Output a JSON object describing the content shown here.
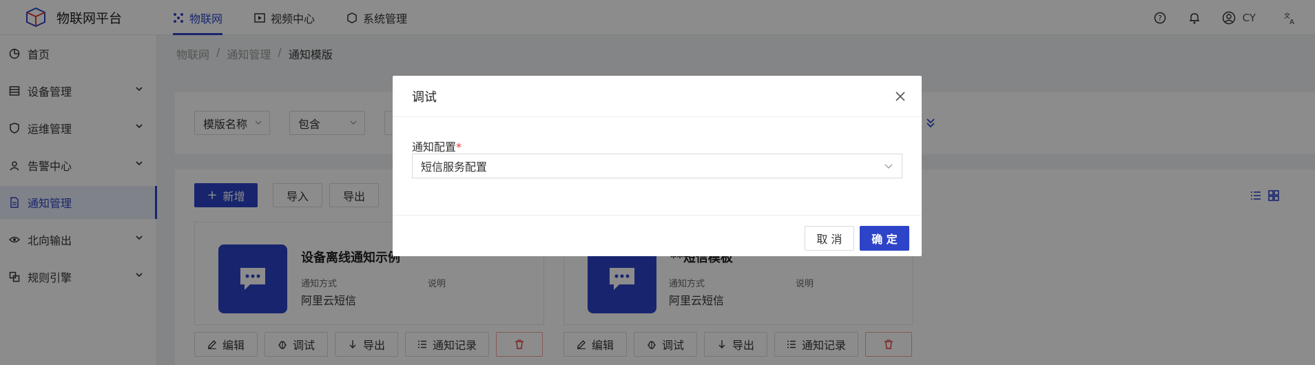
{
  "header": {
    "app_title": "物联网平台",
    "nav": [
      {
        "label": "物联网",
        "icon": "iot-grid-icon"
      },
      {
        "label": "视频中心",
        "icon": "video-play-icon"
      },
      {
        "label": "系统管理",
        "icon": "system-cube-icon"
      }
    ],
    "user": "CY"
  },
  "sidebar": {
    "items": [
      {
        "label": "首页",
        "icon": "dashboard-icon"
      },
      {
        "label": "设备管理",
        "icon": "device-list-icon"
      },
      {
        "label": "运维管理",
        "icon": "shield-icon"
      },
      {
        "label": "告警中心",
        "icon": "alarm-icon"
      },
      {
        "label": "通知管理",
        "icon": "document-icon"
      },
      {
        "label": "北向输出",
        "icon": "eye-icon"
      },
      {
        "label": "规则引擎",
        "icon": "rule-icon"
      }
    ]
  },
  "breadcrumb": [
    "物联网",
    "/",
    "通知管理",
    "/",
    "通知模版"
  ],
  "filter": {
    "field": "模版名称",
    "operator": "包含"
  },
  "toolbar": {
    "add": "新增",
    "import": "导入",
    "export": "导出"
  },
  "cards": [
    {
      "title": "设备离线通知示例",
      "method_label": "通知方式",
      "desc_label": "说明",
      "method_value": "阿里云短信"
    },
    {
      "title": "**短信模板",
      "method_label": "通知方式",
      "desc_label": "说明",
      "method_value": "阿里云短信"
    }
  ],
  "card_actions": {
    "edit": "编辑",
    "debug": "调试",
    "export": "导出",
    "records": "通知记录"
  },
  "modal": {
    "title": "调试",
    "field_label": "通知配置",
    "required_mark": "*",
    "selected": "短信服务配置",
    "cancel": "取 消",
    "ok": "确 定"
  },
  "colors": {
    "primary": "#2d44c8",
    "danger": "#e53935"
  }
}
